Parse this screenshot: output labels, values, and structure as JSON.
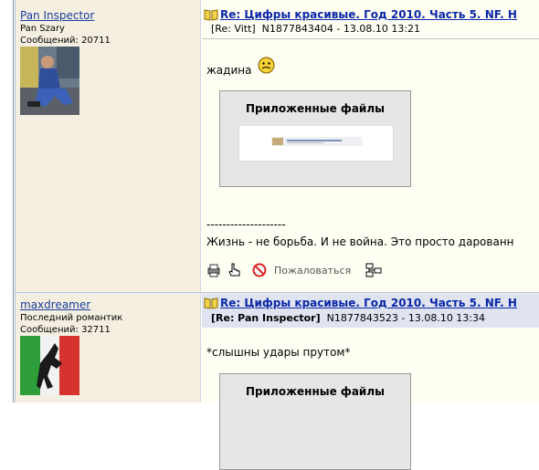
{
  "posts": [
    {
      "author": "Pan Inspector",
      "rank": "Pan Szary",
      "messages_label": "Сообщений:",
      "messages_count": "20711",
      "title": "Re: Цифры красивые. Год 2010. Часть 5. NF. H",
      "reply_to": "[Re: Vitt]",
      "post_id": "N1877843404",
      "date": "13.08.10 13:21",
      "body_line1": "жадина",
      "attachments_title": "Приложенные файлы",
      "divider": "--------------------",
      "signature": "Жизнь - не борьба. И не война. Это просто дарованн",
      "complain_label": "Пожаловаться"
    },
    {
      "author": "maxdreamer",
      "rank": "Последний романтик",
      "messages_label": "Сообщений:",
      "messages_count": "32711",
      "title": "Re: Цифры красивые. Год 2010. Часть 5. NF. H",
      "reply_to": "[Re: Pan Inspector]",
      "post_id": "N1877843523",
      "date": "13.08.10 13:34",
      "body_line1": "*слышны удары прутом*",
      "attachments_title": "Приложенные файлы"
    }
  ],
  "icons": [
    "print-icon",
    "hand-pointer-icon",
    "stop-icon",
    "tree-view-icon",
    "book-icon",
    "smiley-icon"
  ],
  "colors": {
    "link": "#1b3c9e",
    "title": "#0b27a8",
    "left_bg": "#f4efe1",
    "right_bg": "#fffff4"
  }
}
